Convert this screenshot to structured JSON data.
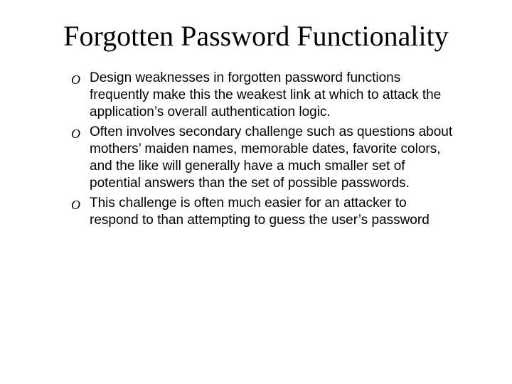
{
  "slide": {
    "title": "Forgotten Password Functionality",
    "bullets": [
      {
        "marker": "O",
        "text": "Design weaknesses in forgotten password functions frequently make this the weakest link at which to attack the application’s overall authentication logic."
      },
      {
        "marker": "O",
        "text": "Often involves secondary challenge such as questions about mothers’ maiden names, memorable dates, favorite colors, and the like will generally have a much smaller set of potential answers than the set of possible passwords."
      },
      {
        "marker": "O",
        "text": "This challenge is often much easier for an attacker to respond to than attempting to guess the user’s password"
      }
    ]
  }
}
